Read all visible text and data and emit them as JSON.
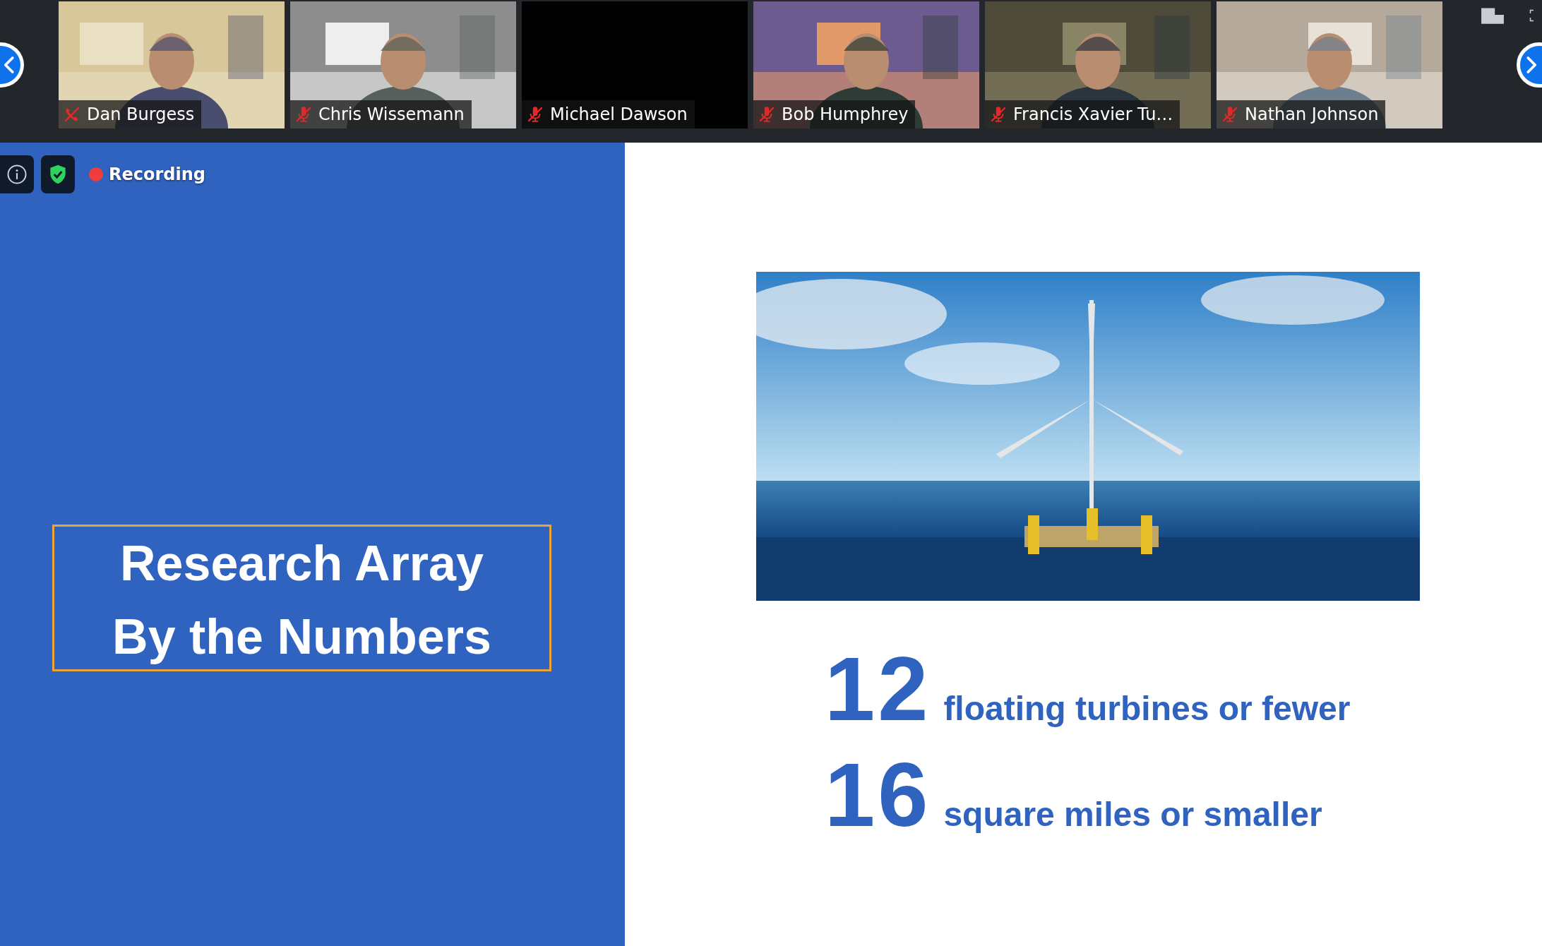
{
  "gallery": {
    "participants": [
      {
        "name": "Dan Burgess",
        "kind": "phone",
        "muted": true,
        "camera_on": true
      },
      {
        "name": "Chris Wissemann",
        "kind": "mic",
        "muted": true,
        "camera_on": true
      },
      {
        "name": "Michael Dawson",
        "kind": "mic",
        "muted": true,
        "camera_on": false
      },
      {
        "name": "Bob Humphrey",
        "kind": "mic",
        "muted": true,
        "camera_on": true
      },
      {
        "name": "Francis Xavier Tu…",
        "kind": "mic",
        "muted": true,
        "camera_on": true
      },
      {
        "name": "Nathan Johnson",
        "kind": "mic",
        "muted": true,
        "camera_on": true
      }
    ]
  },
  "meeting": {
    "recording_label": "Recording",
    "recording": true
  },
  "slide": {
    "title": "Research Array\nBy the Numbers",
    "stats": [
      {
        "number": "12",
        "text": "floating turbines or fewer"
      },
      {
        "number": "16",
        "text": "square miles or smaller"
      }
    ]
  }
}
